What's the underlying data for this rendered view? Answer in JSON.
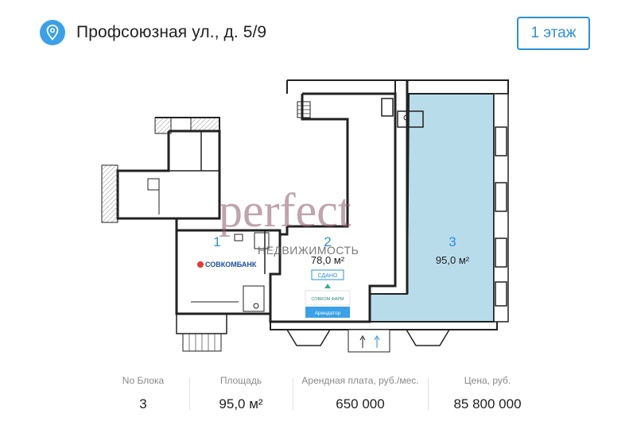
{
  "header": {
    "address": "Профсоюзная ул., д. 5/9",
    "floor_button": "1 этаж",
    "pin_icon": "location-pin-icon",
    "accent_color": "#3aa0e8"
  },
  "plan": {
    "watermark_brand": "perfect",
    "watermark_sub": "НЕДВИЖИМОСТЬ",
    "block1": {
      "number": "1",
      "tenant_logo": "СОВКОМБАНК"
    },
    "block2": {
      "number": "2",
      "area": "78,0 м²",
      "badge": "СДАНО",
      "tenant_logo": "СОВКОМ ФАРМ",
      "tenant_tag": "Арендатор"
    },
    "block3": {
      "number": "3",
      "area": "95,0 м²"
    },
    "highlight_color": "#b9dcea"
  },
  "stats": {
    "block_label": "No Блока",
    "block_value": "3",
    "area_label": "Площадь",
    "area_value": "95,0 м²",
    "rent_label": "Арендная плата, руб./мес.",
    "rent_value": "650 000",
    "price_label": "Цена, руб.",
    "price_value": "85 800 000"
  }
}
